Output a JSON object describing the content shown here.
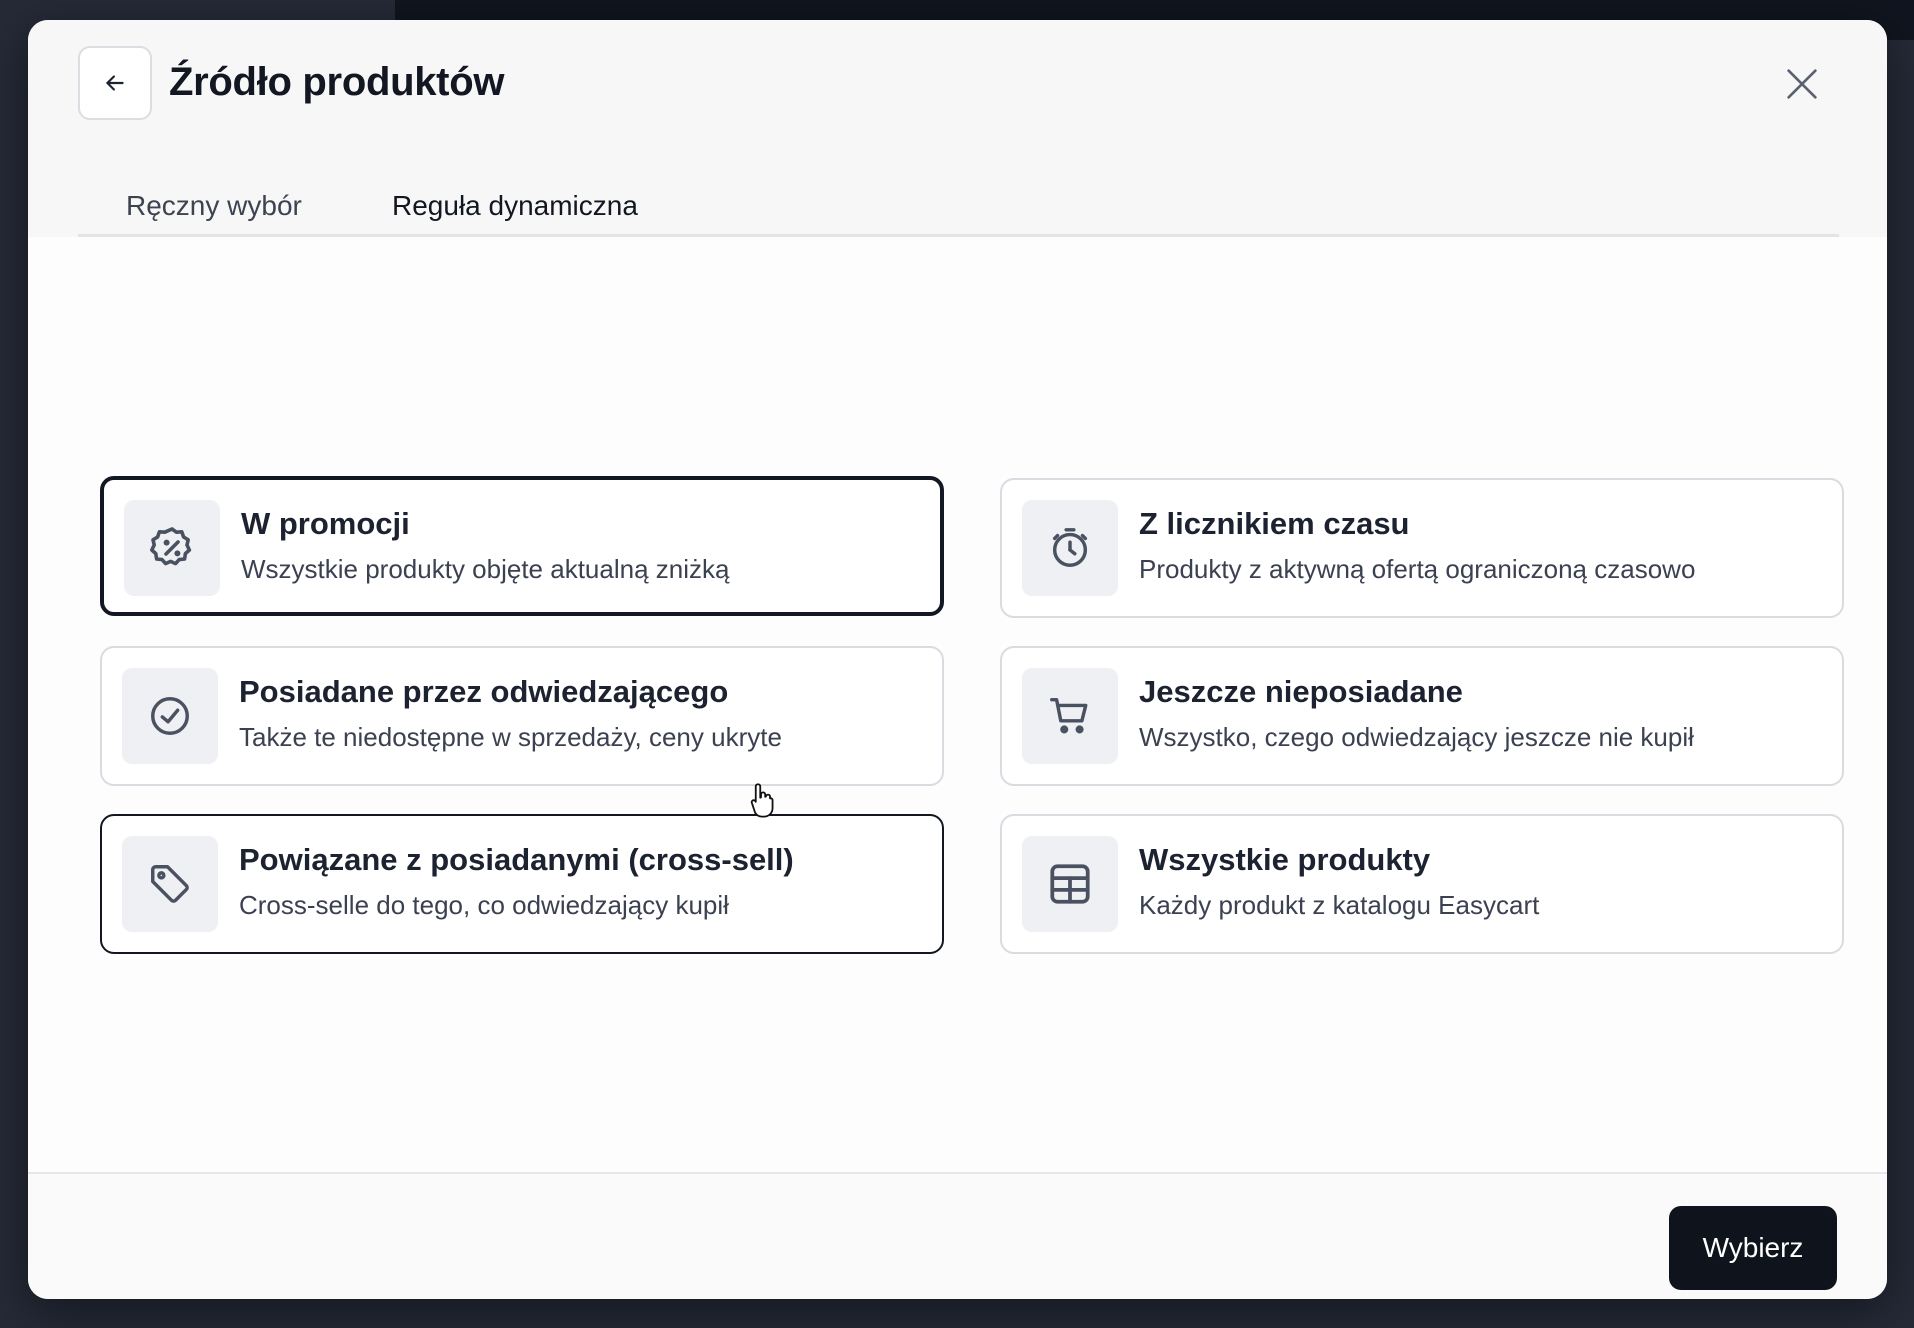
{
  "dialog": {
    "title": "Źródło produktów",
    "back_icon": "arrow-left-icon",
    "close_icon": "close-icon"
  },
  "tabs": [
    {
      "label": "Ręczny wybór",
      "active": false
    },
    {
      "label": "Reguła dynamiczna",
      "active": true
    }
  ],
  "options": [
    {
      "title": "W promocji",
      "description": "Wszystkie produkty objęte aktualną zniżką",
      "icon": "discount-badge-icon",
      "selected": true
    },
    {
      "title": "Z licznikiem czasu",
      "description": "Produkty z aktywną ofertą ograniczoną czasowo",
      "icon": "timer-icon",
      "selected": false
    },
    {
      "title": "Posiadane przez odwiedzającego",
      "description": "Także te niedostępne w sprzedaży, ceny ukryte",
      "icon": "check-circle-icon",
      "selected": false
    },
    {
      "title": "Jeszcze nieposiadane",
      "description": "Wszystko, czego odwiedzający jeszcze nie kupił",
      "icon": "cart-icon",
      "selected": false
    },
    {
      "title": "Powiązane z posiadanymi (cross-sell)",
      "description": "Cross-selle do tego, co odwiedzający kupił",
      "icon": "tag-icon",
      "selected": false
    },
    {
      "title": "Wszystkie produkty",
      "description": "Każdy produkt z katalogu Easycart",
      "icon": "grid-icon",
      "selected": false
    }
  ],
  "footer": {
    "confirm_label": "Wybierz"
  },
  "colors": {
    "primary": "#0f141c",
    "card_border": "#d9dbe0",
    "icon_bg": "#eef0f3"
  }
}
